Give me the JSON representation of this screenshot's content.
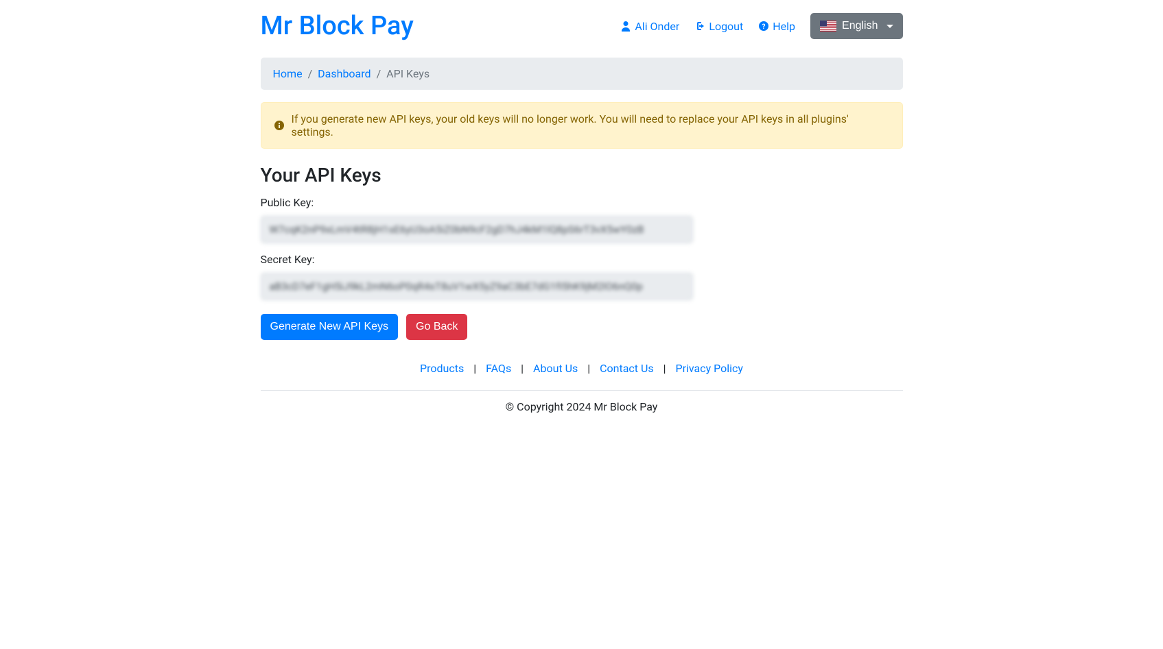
{
  "brand": "Mr Block Pay",
  "nav": {
    "user": "Ali Onder",
    "logout": "Logout",
    "help": "Help",
    "language": "English"
  },
  "breadcrumb": {
    "home": "Home",
    "dashboard": "Dashboard",
    "current": "API Keys"
  },
  "alert": {
    "message": "If you generate new API keys, your old keys will no longer work. You will need to replace your API keys in all plugins' settings."
  },
  "page": {
    "title": "Your API Keys",
    "public_key_label": "Public Key:",
    "public_key_value": "W7cqK2nP9xLmV4tR8jH1sE6yU3oA5iZ0bN9cF2gD7hJ4kM1lQ8pS6rT3vX5wY0zB",
    "secret_key_label": "Secret Key:",
    "secret_key_value": "aB3cD7eF1gH5iJ9kL2mN6oP0qR4sT8uV1wX5yZ9aC3bE7dG1fI5hK9jM2lO6nQ0p",
    "generate_label": "Generate New API Keys",
    "go_back_label": "Go Back"
  },
  "footer": {
    "products": "Products",
    "faqs": "FAQs",
    "about": "About Us",
    "contact": "Contact Us",
    "privacy": "Privacy Policy",
    "copyright": "© Copyright 2024 Mr Block Pay"
  }
}
